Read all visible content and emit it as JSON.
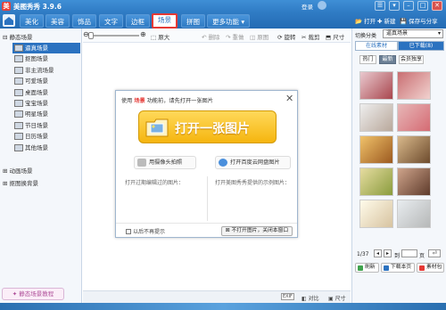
{
  "window": {
    "title": "美图秀秀 3.9.6",
    "login": "登录",
    "user_icon": "user-icon"
  },
  "nav": {
    "tabs": [
      "美化",
      "美容",
      "饰品",
      "文字",
      "边框",
      "场景",
      "拼图",
      "更多功能 ▾"
    ],
    "active_tab": "场景",
    "open_label": "打开",
    "new_label": "新建",
    "save_label": "保存与分享"
  },
  "toolbar": {
    "zoom_value": "100%",
    "original_size": "原大",
    "undo": "撤销",
    "redo": "重做",
    "original": "原图",
    "rotate": "旋转",
    "crop": "裁剪",
    "size": "尺寸",
    "delete": "删除"
  },
  "sidebar": {
    "group1": "静态场景",
    "items": [
      "逼真场景",
      "抠图场景",
      "非主流场景",
      "可爱场景",
      "桌面场景",
      "宝宝场景",
      "明星场景",
      "节日场景",
      "日历场景",
      "其他场景"
    ],
    "selected": "逼真场景",
    "group2": "动画场景",
    "group3": "抠图换背景",
    "tutorial": "静态场景教程"
  },
  "dialog": {
    "head_prefix": "使用",
    "head_highlight": "场景",
    "head_suffix": "功能前，请先打开一张图片",
    "open_button": "打开一张图片",
    "camera_button": "用摄像头拍照",
    "baidu_button": "打开百度云网盘图片",
    "note_left": "打开过期编辑过的图片：",
    "note_right": "打开美图秀秀提供的示例图片：",
    "noshow": "以后不再提示",
    "cancel": "不打开图片，关闭本窗口"
  },
  "statusbar": {
    "badge": "EXIF",
    "compare": "对比",
    "resize": "尺寸"
  },
  "right_panel": {
    "category_label": "切换分类",
    "category_value": "逼真场景",
    "tab_online": "在线素材",
    "tab_downloaded": "已下载(8)",
    "chips": [
      "热门",
      "最新",
      "会员独享"
    ],
    "active_chip": "最新",
    "page_counter": "1/37",
    "goto_label": "到",
    "page_suffix": "页",
    "refresh": "刷新",
    "download_page": "下载本页",
    "material_package": "素材包"
  },
  "colors": {
    "brand_blue": "#2b72c0",
    "highlight_red": "#e53935",
    "open_button_yellow": "#f5b50f"
  }
}
